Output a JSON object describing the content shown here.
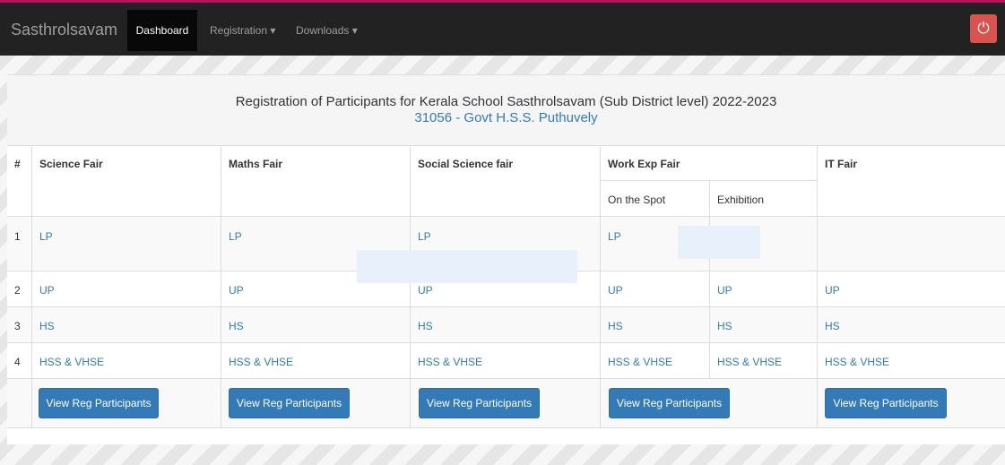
{
  "navbar": {
    "brand": "Sasthrolsavam",
    "dashboard": "Dashboard",
    "registration": "Registration ▾",
    "downloads": "Downloads ▾",
    "power_icon": "⏻"
  },
  "heading": {
    "title": "Registration of Participants for Kerala School Sasthrolsavam (Sub District level) 2022-2023",
    "school": "31056 - Govt H.S.S. Puthuvely"
  },
  "table": {
    "headers": {
      "num": "#",
      "science": "Science Fair",
      "maths": "Maths Fair",
      "social": "Social Science fair",
      "workexp": "Work Exp Fair",
      "onspot": "On the Spot",
      "exhibition": "Exhibition",
      "it": "IT Fair"
    },
    "rows": [
      {
        "num": "1",
        "science": "LP",
        "maths": "LP",
        "social": "LP",
        "onspot": "LP",
        "exhibition": "",
        "it": ""
      },
      {
        "num": "2",
        "science": "UP",
        "maths": "UP",
        "social": "UP",
        "onspot": "UP",
        "exhibition": "UP",
        "it": "UP"
      },
      {
        "num": "3",
        "science": "HS",
        "maths": "HS",
        "social": "HS",
        "onspot": "HS",
        "exhibition": "HS",
        "it": "HS"
      },
      {
        "num": "4",
        "science": "HSS & VHSE",
        "maths": "HSS & VHSE",
        "social": "HSS & VHSE",
        "onspot": "HSS & VHSE",
        "exhibition": "HSS & VHSE",
        "it": "HSS & VHSE"
      }
    ],
    "button_label": "View Reg Participants"
  }
}
